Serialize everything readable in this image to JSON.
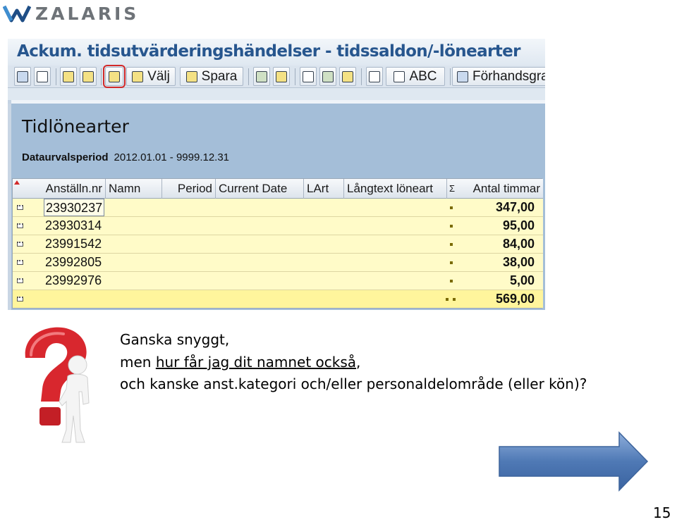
{
  "brand": {
    "logo_text": "ZALARIS"
  },
  "window": {
    "title": "Ackum. tidsutvärderingshändelser - tidssaldon/-lönearter"
  },
  "toolbar": {
    "buttons": [
      {
        "name": "details-button",
        "icon": "magnifier-icon"
      },
      {
        "name": "filter-button",
        "icon": "filter-icon"
      },
      {
        "name": "print-button",
        "icon": "printer-icon"
      },
      {
        "name": "sort-button",
        "icon": "sort-icon"
      },
      {
        "name": "layout-change-button",
        "icon": "layout-icon"
      },
      {
        "name": "layout-select-button",
        "icon": "layout-icon",
        "label": "Välj"
      },
      {
        "name": "layout-save-button",
        "icon": "layout-icon",
        "label": "Spara"
      },
      {
        "name": "sum-button",
        "icon": "sigma-icon"
      },
      {
        "name": "subtotal-button",
        "icon": "subtotal-icon"
      },
      {
        "name": "export-button",
        "icon": "export-icon"
      },
      {
        "name": "send-button",
        "icon": "send-icon"
      },
      {
        "name": "edit-button",
        "icon": "edit-icon"
      },
      {
        "name": "spreadsheet-button",
        "icon": "spreadsheet-icon"
      },
      {
        "name": "word-button",
        "icon": "spreadsheet-icon",
        "label": "ABC"
      },
      {
        "name": "preview-button",
        "icon": "preview-icon",
        "label": "Förhandsgran"
      }
    ]
  },
  "report": {
    "heading": "Tidlönearter",
    "period_label": "Dataurvalsperiod",
    "period_value": "2012.01.01 - 9999.12.31"
  },
  "grid": {
    "columns": [
      "Anställn.nr",
      "Namn",
      "Period",
      "Current Date",
      "LArt",
      "Långtext löneart",
      "Σ",
      "Antal timmar"
    ],
    "rows": [
      {
        "employee": "23930237",
        "hours": "347,00"
      },
      {
        "employee": "23930314",
        "hours": "95,00"
      },
      {
        "employee": "23991542",
        "hours": "84,00"
      },
      {
        "employee": "23992805",
        "hours": "38,00"
      },
      {
        "employee": "23992976",
        "hours": "5,00"
      }
    ],
    "total": {
      "hours": "569,00"
    }
  },
  "text": {
    "line1": "Ganska snyggt,",
    "line2_prefix": "men ",
    "line2_link": "hur får jag dit namnet också",
    "line2_suffix": ",",
    "line3": "och kanske anst.kategori och/eller personaldelområde (eller kön)?"
  },
  "page": {
    "number": "15"
  },
  "colors": {
    "title_blue": "#27568e",
    "grid_row": "#fffbc8",
    "grid_total": "#fff59c",
    "highlight_red": "#d22a2a",
    "arrow_blue": "#4f79b5"
  }
}
